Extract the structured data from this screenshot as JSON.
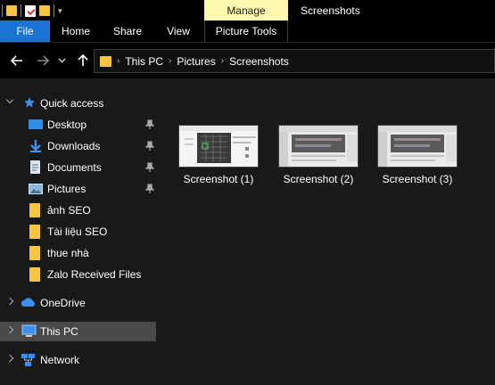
{
  "titlebar": {
    "manage_label": "Manage",
    "window_title": "Screenshots",
    "quick_access_icons": [
      "folder-icon",
      "properties-icon",
      "new-folder-icon",
      "customize-dropdown-icon"
    ]
  },
  "ribbon": {
    "tabs": [
      {
        "label": "File",
        "active_color": "#1a73d4"
      },
      {
        "label": "Home"
      },
      {
        "label": "Share"
      },
      {
        "label": "View"
      },
      {
        "label": "Picture Tools"
      }
    ]
  },
  "address_bar": {
    "nav_icons": [
      "back-arrow-icon",
      "forward-arrow-icon",
      "recent-dropdown-icon",
      "up-arrow-icon"
    ],
    "crumbs": [
      "This PC",
      "Pictures",
      "Screenshots"
    ]
  },
  "sidebar": {
    "quick_access": "Quick access",
    "items": [
      {
        "label": "Desktop",
        "icon": "desktop-icon",
        "pinned": true
      },
      {
        "label": "Downloads",
        "icon": "downloads-icon",
        "pinned": true
      },
      {
        "label": "Documents",
        "icon": "documents-icon",
        "pinned": true
      },
      {
        "label": "Pictures",
        "icon": "pictures-icon",
        "pinned": true
      },
      {
        "label": "ảnh SEO",
        "icon": "folder-icon",
        "pinned": false
      },
      {
        "label": "Tài liệu SEO",
        "icon": "folder-icon",
        "pinned": false
      },
      {
        "label": "thue nhà",
        "icon": "folder-icon",
        "pinned": false
      },
      {
        "label": "Zalo Received Files",
        "icon": "folder-icon",
        "pinned": false
      }
    ],
    "onedrive": "OneDrive",
    "this_pc": "This PC",
    "network": "Network"
  },
  "files": [
    {
      "name": "Screenshot (1)"
    },
    {
      "name": "Screenshot (2)"
    },
    {
      "name": "Screenshot (3)"
    }
  ],
  "colors": {
    "accent": "#1a73d4",
    "manage_tab": "#fff9b0",
    "folder": "#f5c542",
    "selected_nav": "#4a4a4a"
  }
}
